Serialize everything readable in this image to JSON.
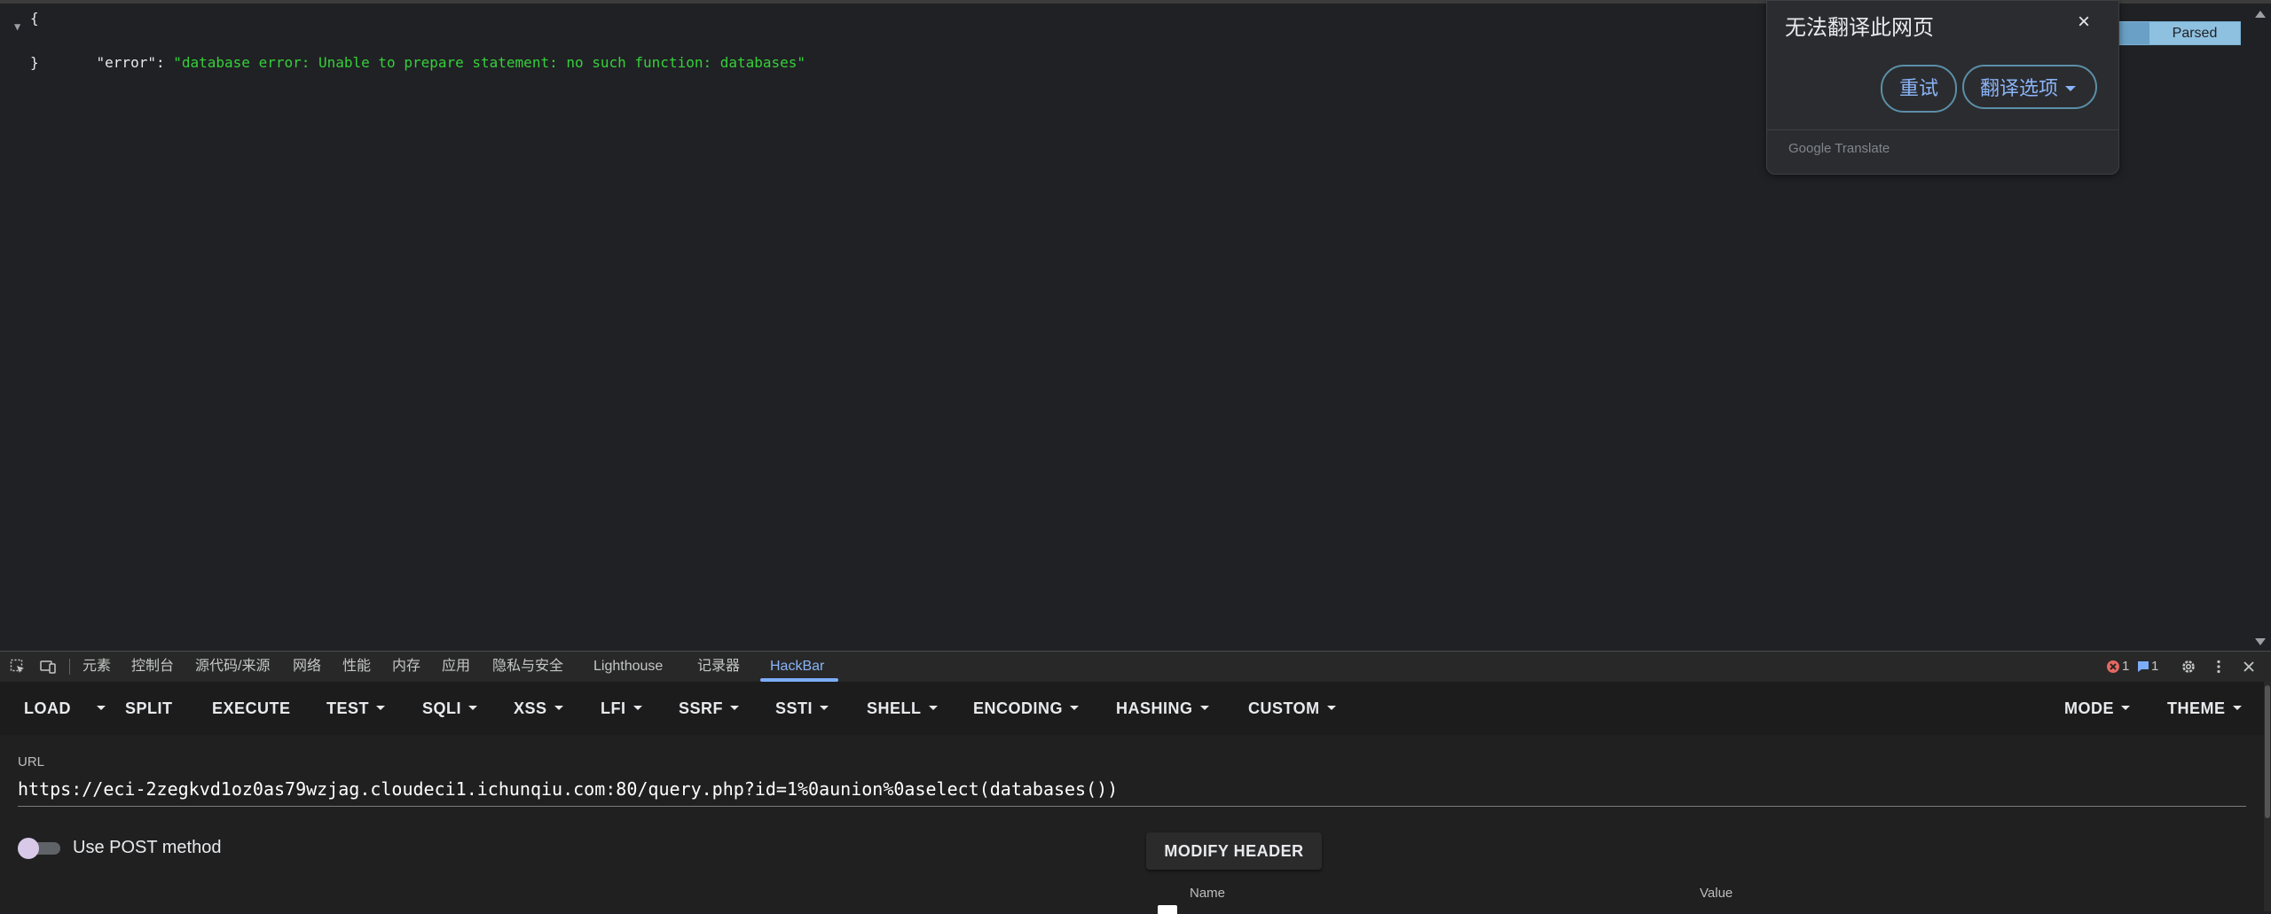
{
  "json_view": {
    "open_brace": "{",
    "key": "\"error\"",
    "colon": ": ",
    "value": "\"database error: Unable to prepare statement: no such function: databases\"",
    "close_brace": "}"
  },
  "view_toggle": {
    "parsed_label": "Parsed",
    "selected": "Parsed"
  },
  "translate_popup": {
    "title": "无法翻译此网页",
    "close": "×",
    "retry_label": "重试",
    "options_label": "翻译选项",
    "brand": "Google Translate"
  },
  "devtools": {
    "tabs": [
      "元素",
      "控制台",
      "源代码/来源",
      "网络",
      "性能",
      "内存",
      "应用",
      "隐私与安全",
      "Lighthouse",
      "记录器",
      "HackBar"
    ],
    "active_tab": "HackBar",
    "error_count": "1",
    "message_count": "1"
  },
  "hackbar": {
    "toolbar": {
      "load": "LOAD",
      "split": "SPLIT",
      "execute": "EXECUTE",
      "test": "TEST",
      "sqli": "SQLI",
      "xss": "XSS",
      "lfi": "LFI",
      "ssrf": "SSRF",
      "ssti": "SSTI",
      "shell": "SHELL",
      "encoding": "ENCODING",
      "hashing": "HASHING",
      "custom": "CUSTOM",
      "mode": "MODE",
      "theme": "THEME"
    },
    "url_label": "URL",
    "url_value": "https://eci-2zegkvd1oz0as79wzjag.cloudeci1.ichunqiu.com:80/query.php?id=1%0aunion%0aselect(databases())",
    "post_method_label": "Use POST method",
    "post_method_enabled": false,
    "modify_header_label": "MODIFY HEADER",
    "header_table": {
      "name_col": "Name",
      "value_col": "Value"
    }
  },
  "colors": {
    "json_string": "#35d03b",
    "accent": "#8ab4f8",
    "background": "#202124"
  }
}
